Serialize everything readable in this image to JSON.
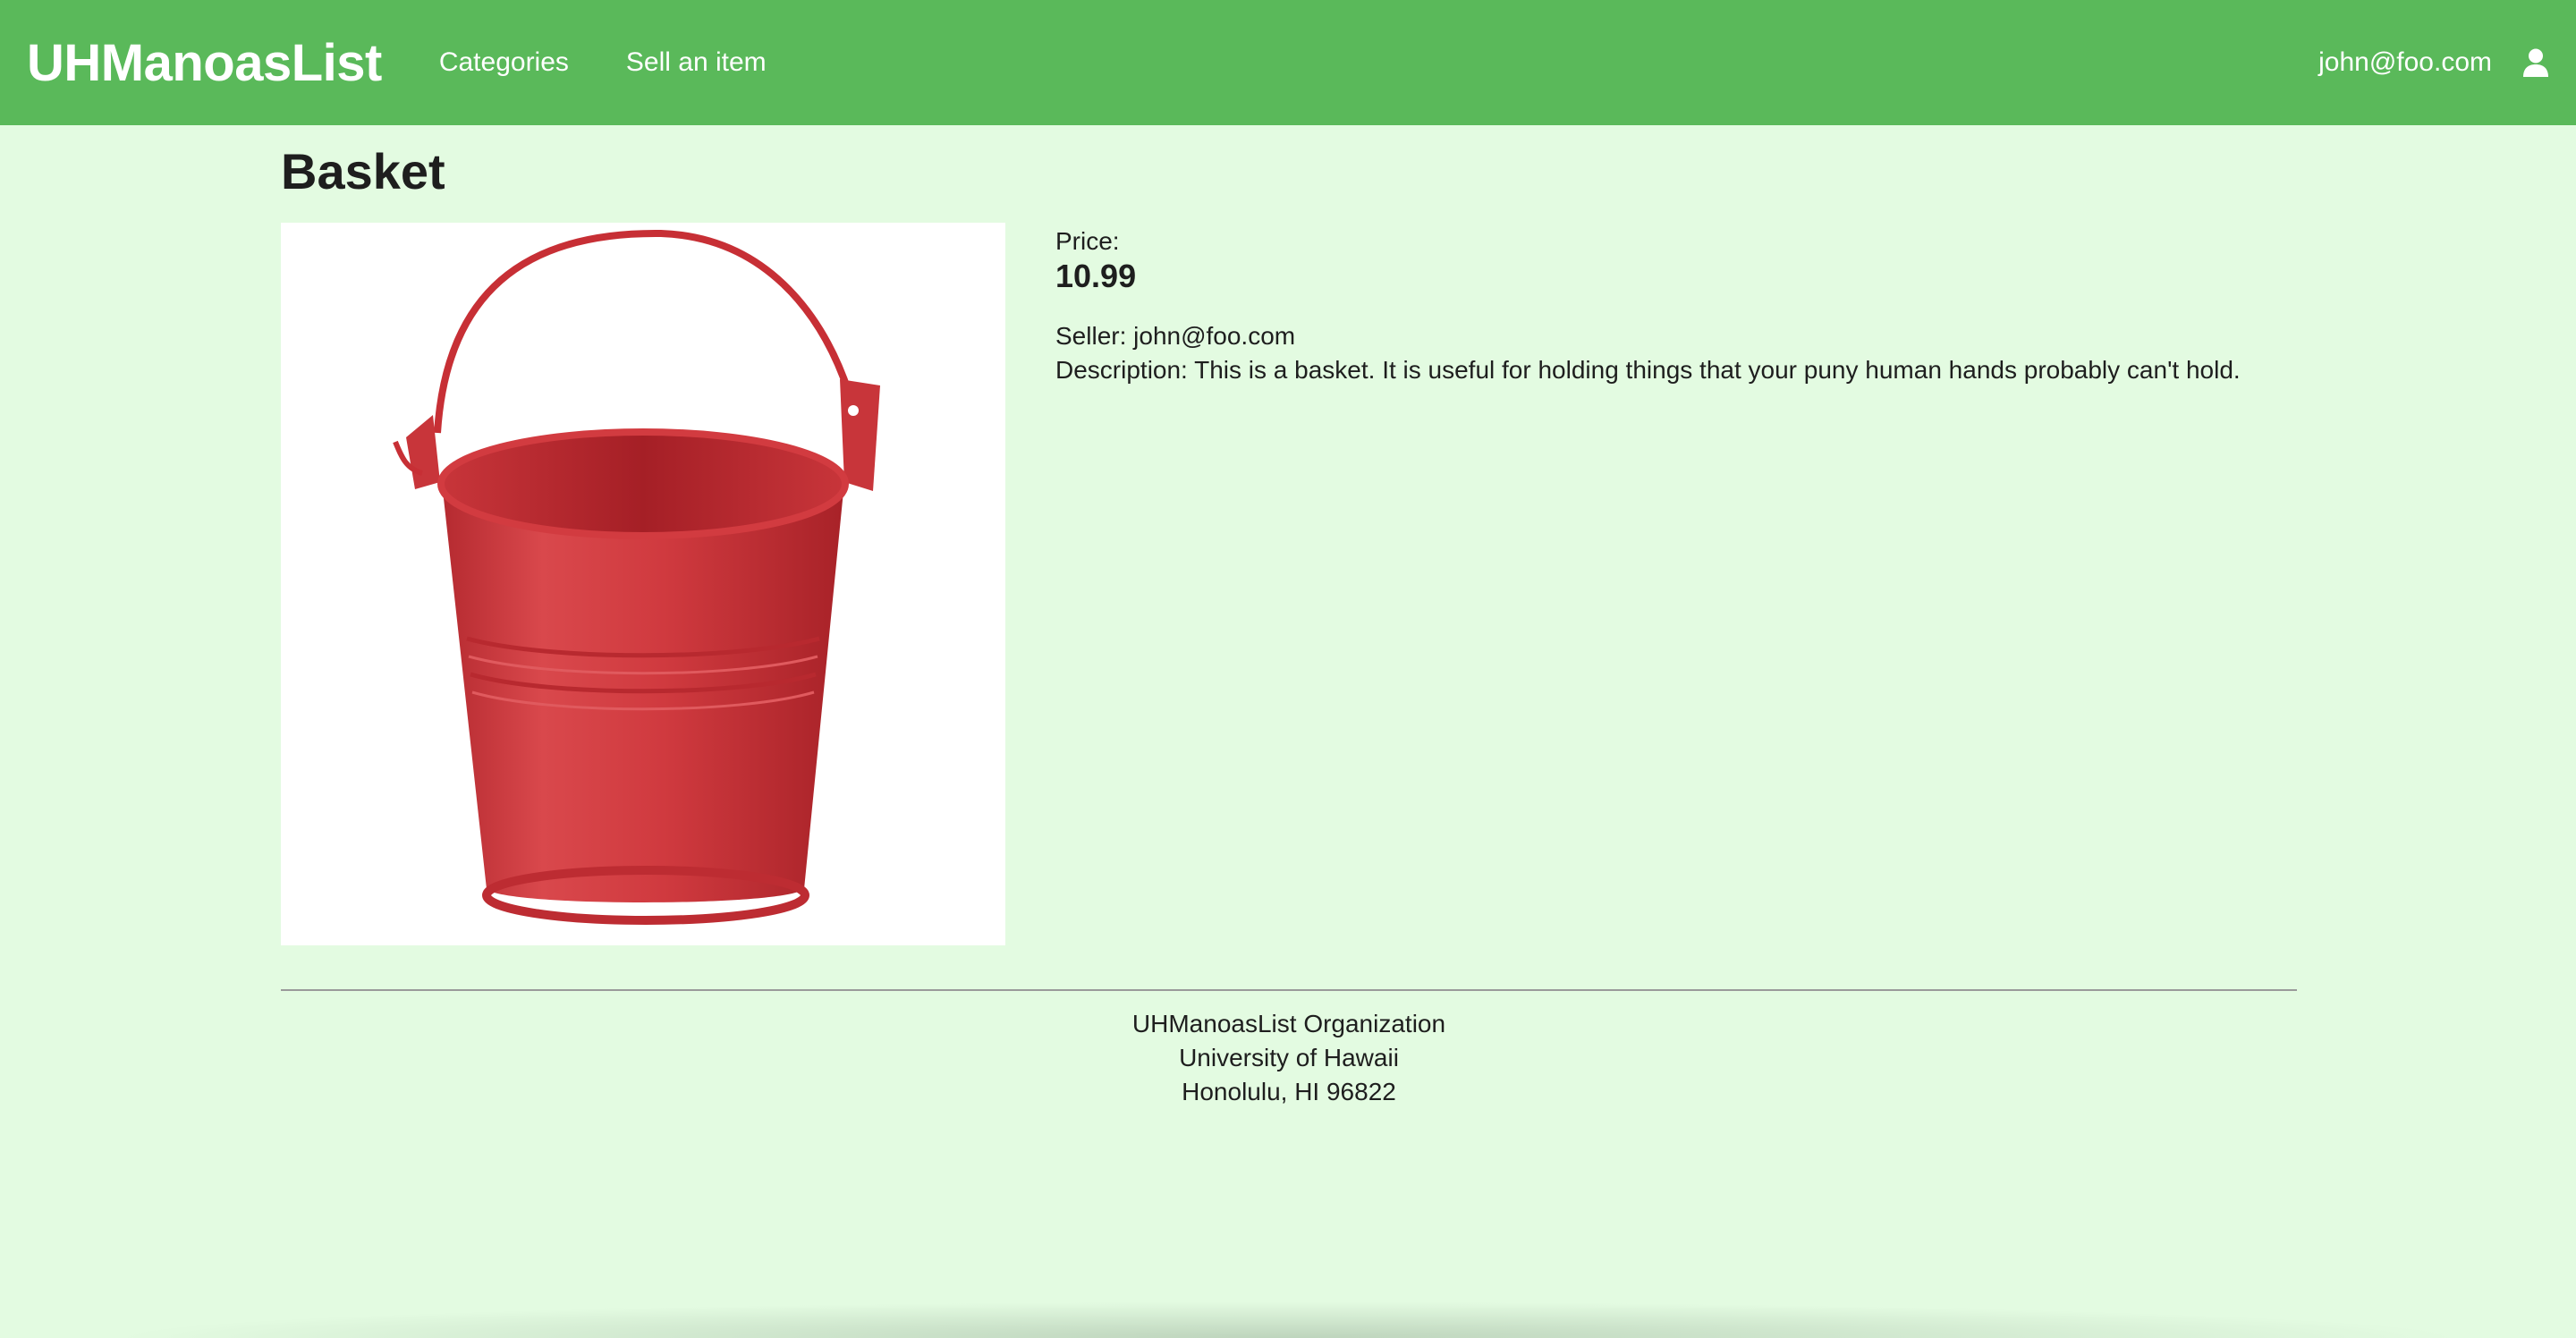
{
  "navbar": {
    "brand": "UHManoasList",
    "links": [
      "Categories",
      "Sell an item"
    ],
    "user_email": "john@foo.com",
    "user_icon": "user-icon"
  },
  "item": {
    "title": "Basket",
    "image_alt": "Basket",
    "price_label": "Price:",
    "price": "10.99",
    "seller_line": "Seller: john@foo.com",
    "description_line": "Description: This is a basket. It is useful for holding things that your puny human hands probably can't hold."
  },
  "footer": {
    "lines": [
      "UHManoasList Organization",
      "University of Hawaii",
      "Honolulu, HI 96822"
    ]
  },
  "colors": {
    "navbar_bg": "#5ab95a",
    "page_bg": "#e3fbe1",
    "bucket_red": "#d0353a"
  }
}
